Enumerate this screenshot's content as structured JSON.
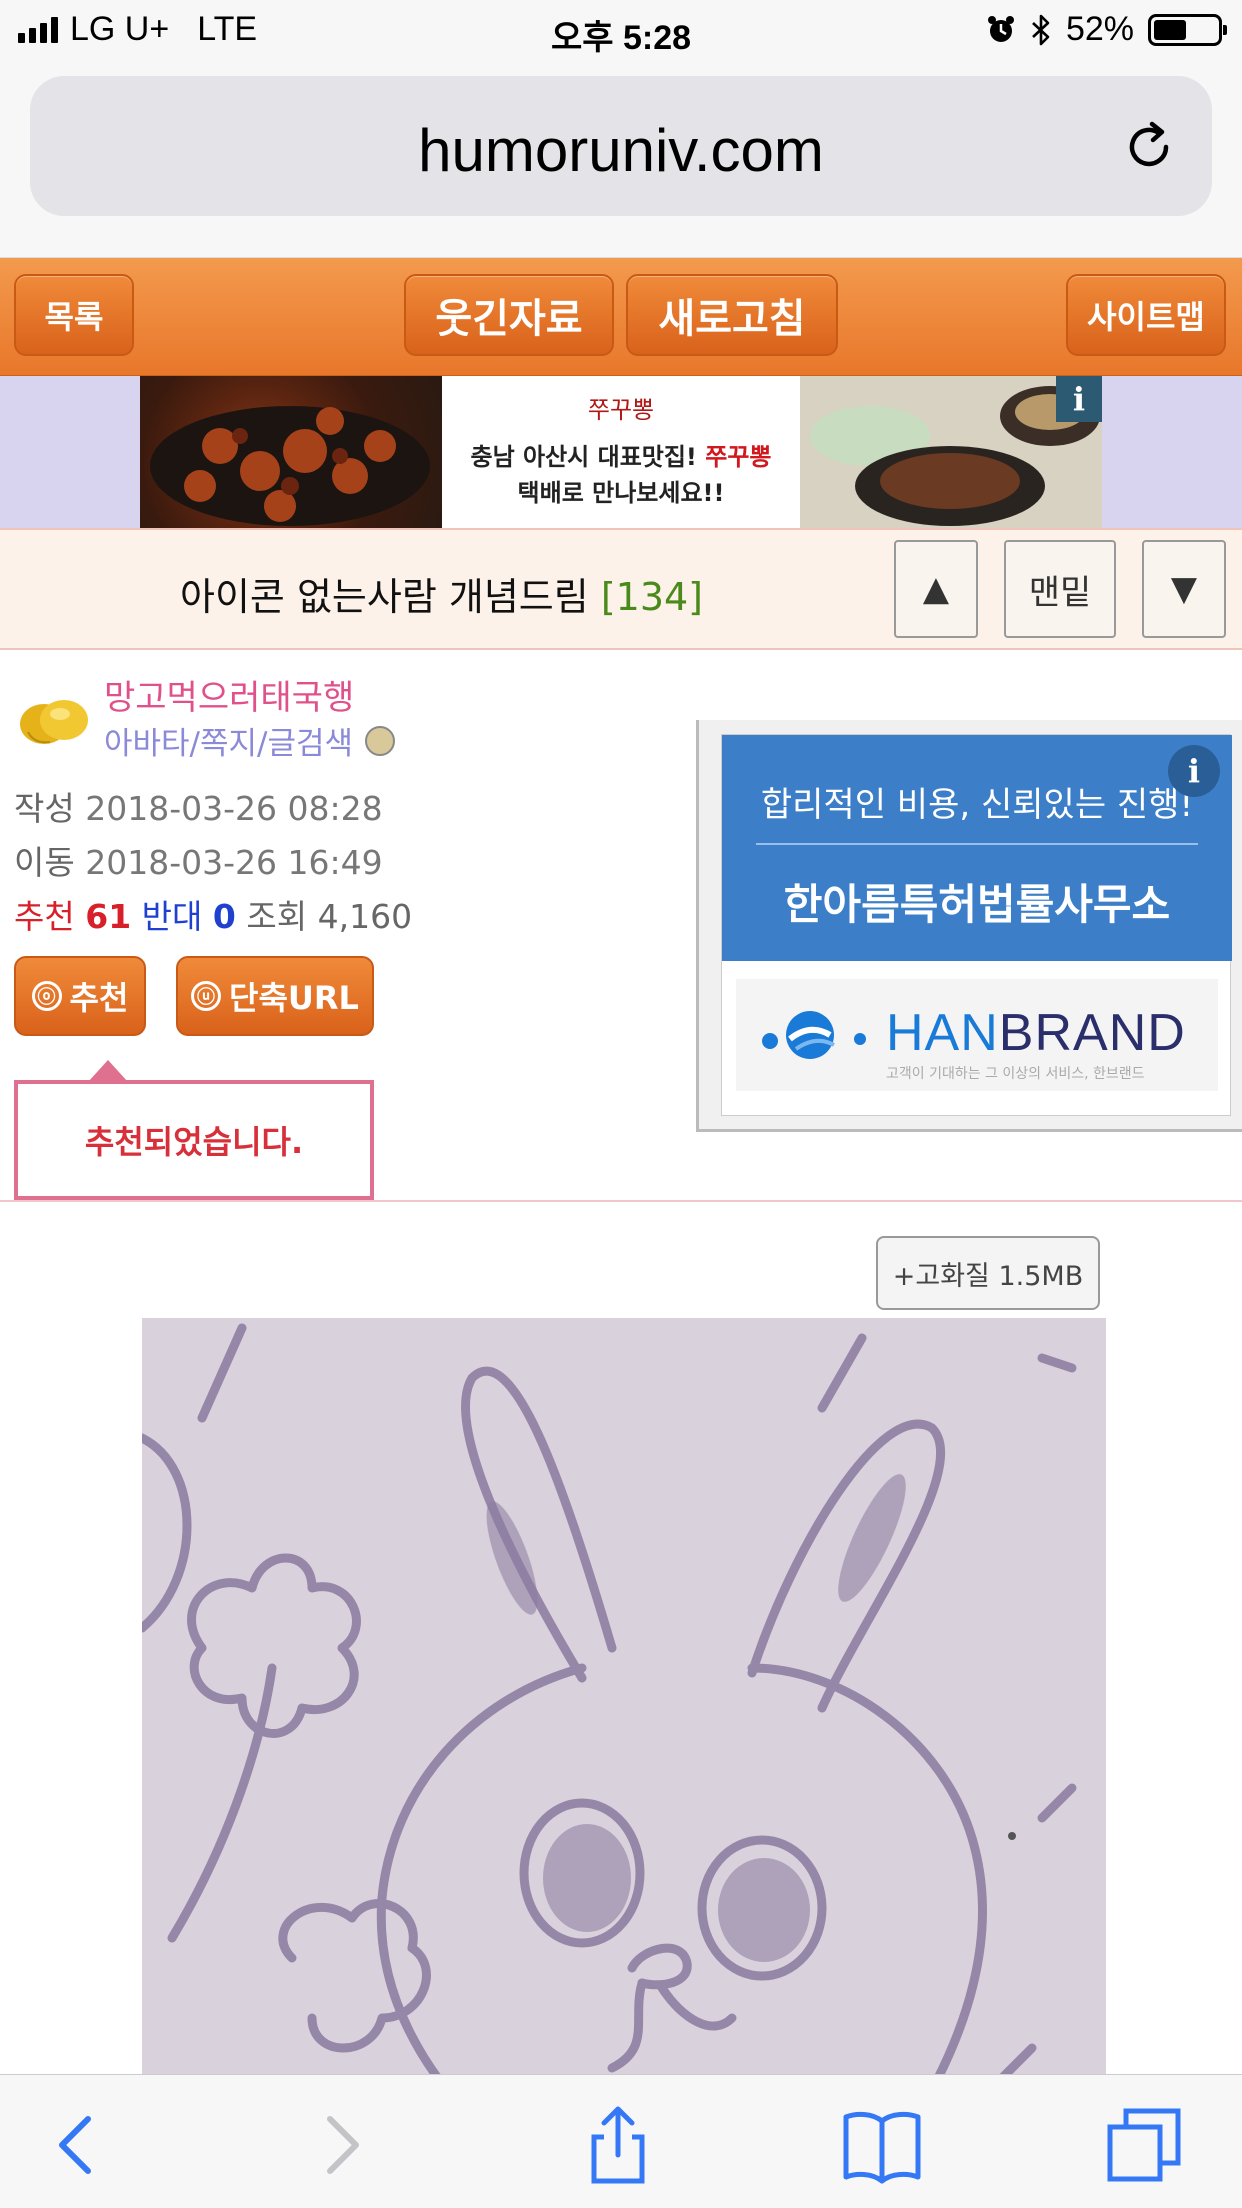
{
  "status_bar": {
    "carrier": "LG U+",
    "network": "LTE",
    "time": "오후 5:28",
    "battery": "52%",
    "battery_level": 0.52
  },
  "browser": {
    "url": "humoruniv.com"
  },
  "nav": {
    "list_label": "목록",
    "funny_label": "웃긴자료",
    "refresh_label": "새로고침",
    "sitemap_label": "사이트맵"
  },
  "top_ad": {
    "logo_text": "쭈꾸뽕",
    "line1_prefix": "충남 아산시 대표맛집! ",
    "line1_brand": "쭈꾸뽕",
    "line2": "택배로 만나보세요!!",
    "info": "i"
  },
  "post": {
    "title": "아이콘 없는사람 개념드림",
    "comment_count": "[134]",
    "up_label": "▲",
    "bottom_label": "맨밑",
    "down_label": "▼"
  },
  "author": {
    "nickname": "망고먹으러태국행",
    "links": "아바타/쪽지/글검색",
    "written_label": "작성",
    "written": "2018-03-26 08:28",
    "moved_label": "이동",
    "moved": "2018-03-26 16:49",
    "recommend_label": "추천",
    "recommend": "61",
    "oppose_label": "반대",
    "oppose": "0",
    "views_label": "조회",
    "views": "4,160"
  },
  "actions": {
    "recommend_icon": "ⓞ",
    "recommend_btn": "추천",
    "short_url_icon": "ⓤ",
    "short_url_btn": "단축URL",
    "tooltip": "추천되었습니다."
  },
  "side_ad": {
    "line1": "합리적인 비용, 신뢰있는 진행!",
    "line2": "한아름특허법률사무소",
    "brand_han": "HAN",
    "brand_rest": "BRAND",
    "tagline": "고객이 기대하는 그 이상의 서비스, 한브랜드",
    "info": "i"
  },
  "content": {
    "hq_label": "+고화질 1.5MB"
  },
  "colors": {
    "nav_orange": "#e8772a",
    "nickname_pink": "#e0508a",
    "recommend_red": "#d8202a",
    "oppose_blue": "#2040d0",
    "ios_blue": "#3478f6"
  }
}
